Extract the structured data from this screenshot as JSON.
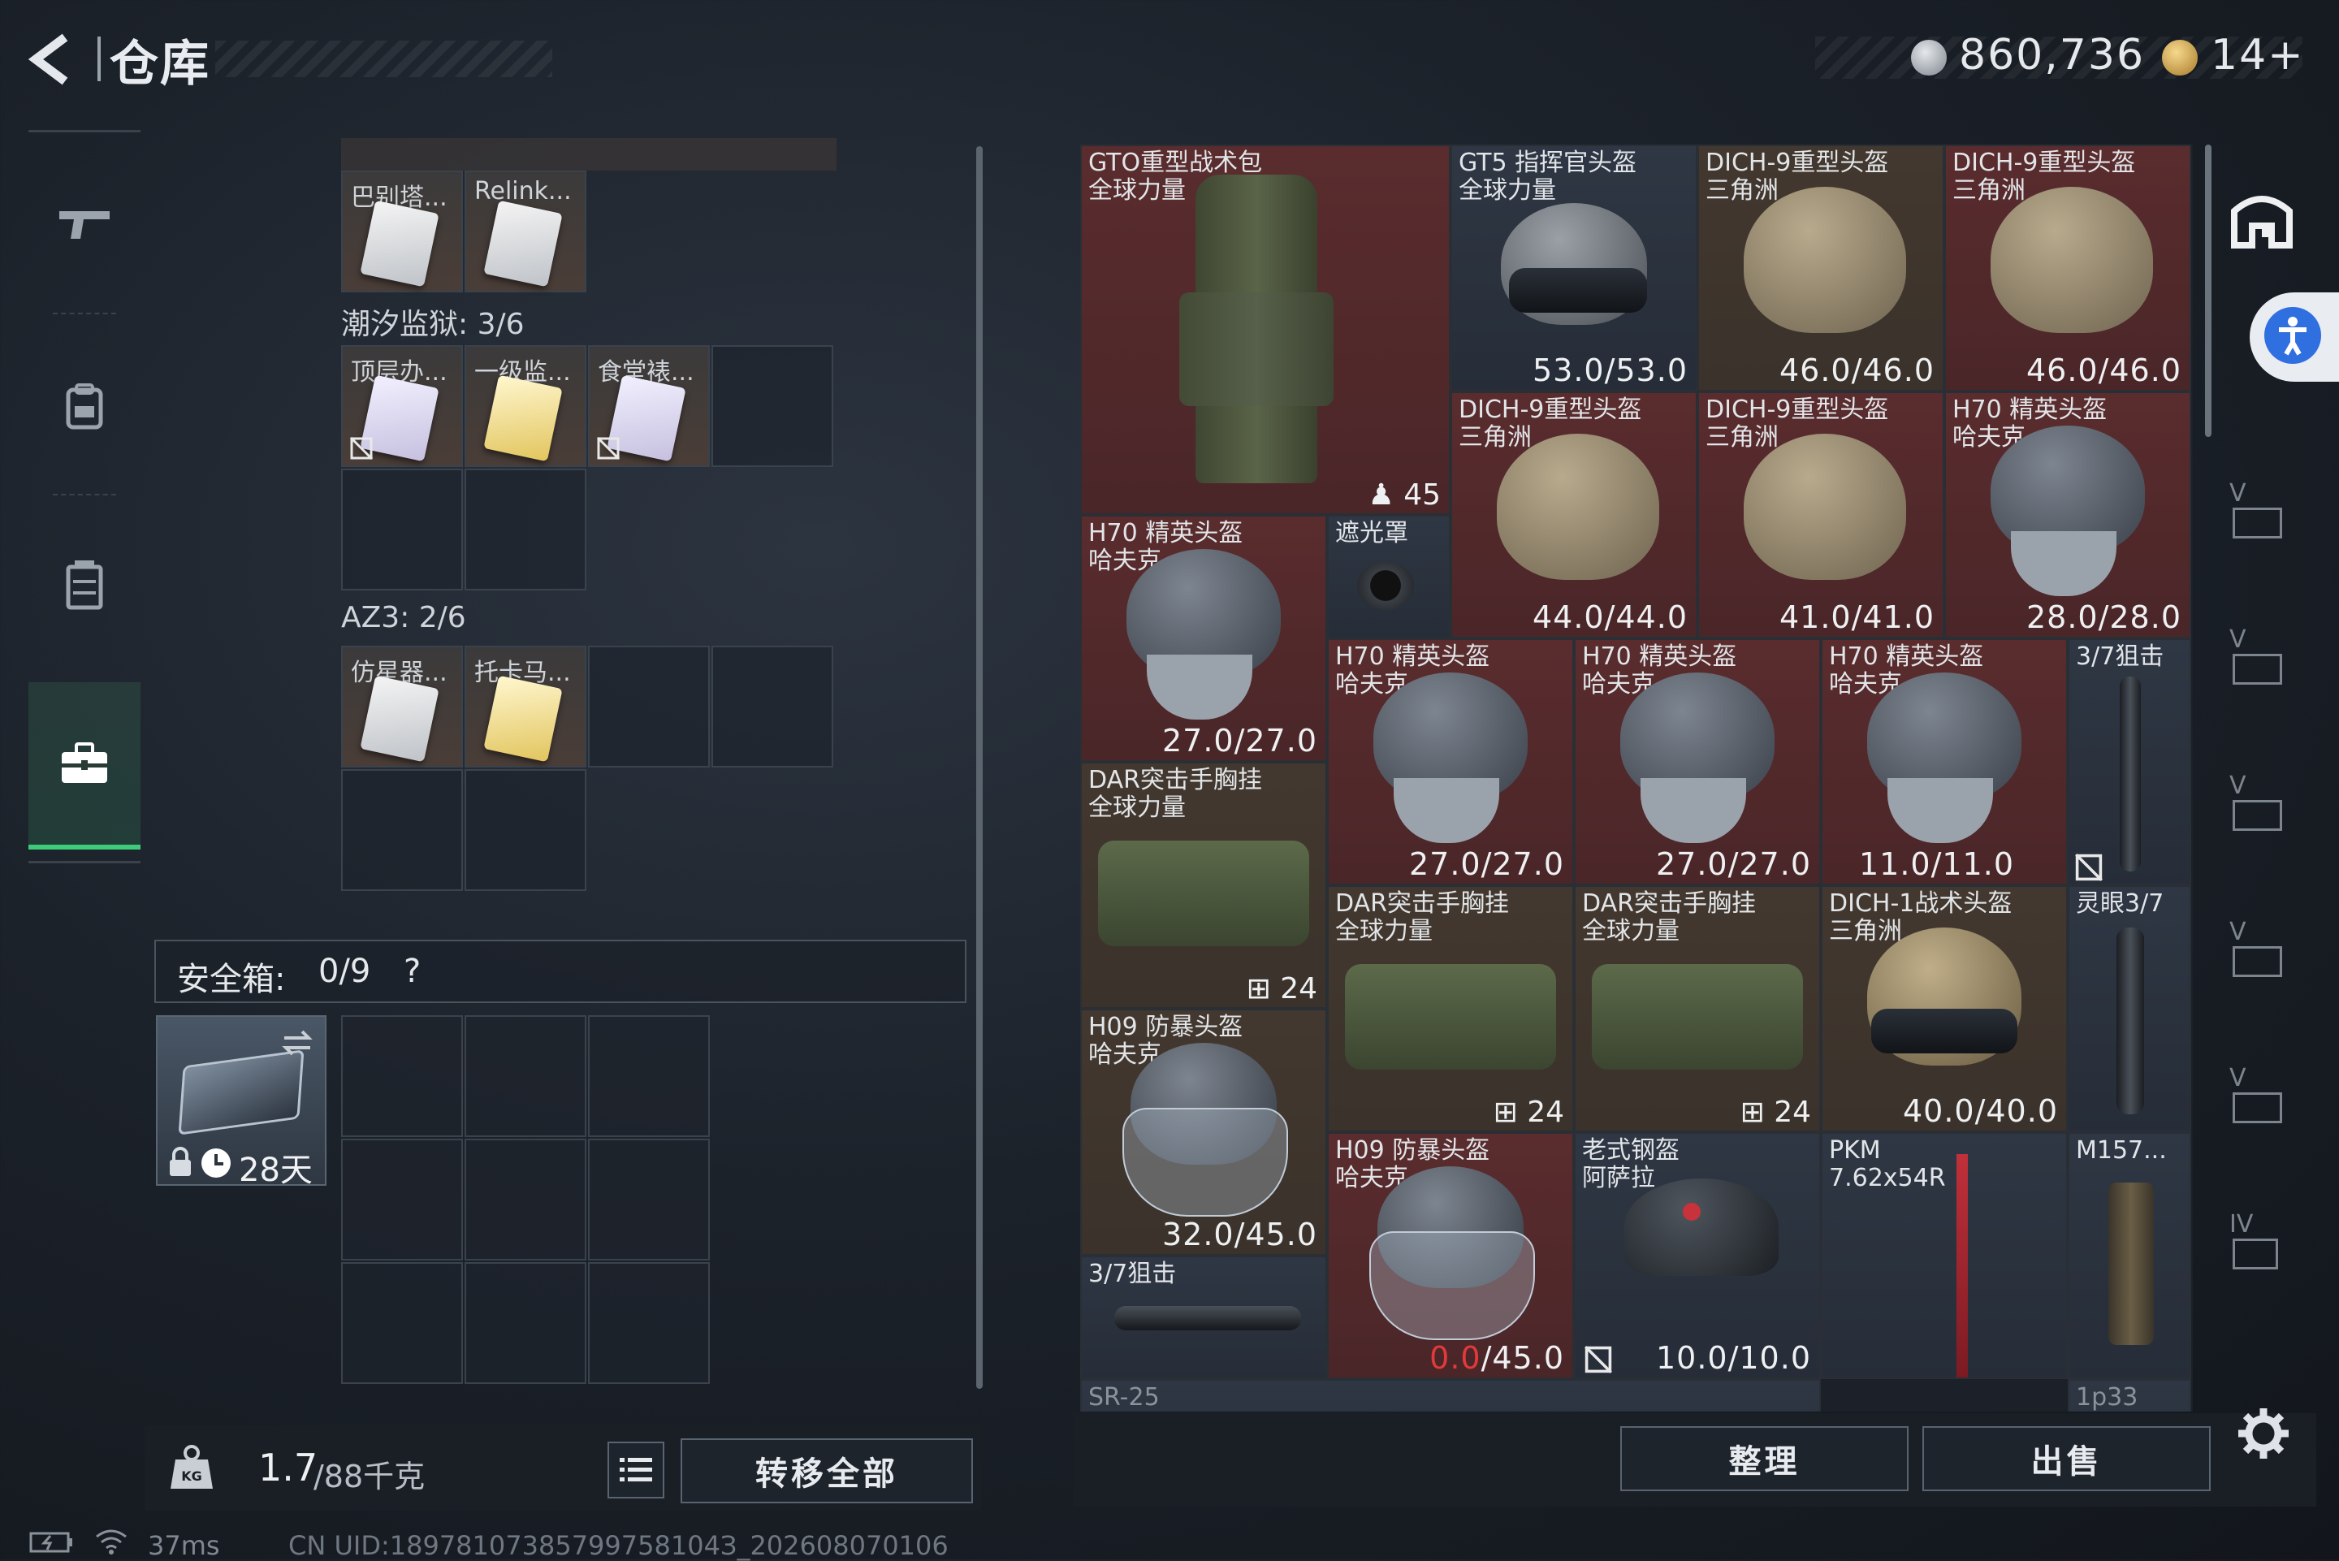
{
  "header": {
    "title": "仓库",
    "currency_amount": "860,736",
    "ticket_amount": "14+"
  },
  "nav": {
    "items": [
      "weapon-icon",
      "backpack-icon",
      "chest-rig-icon",
      "safebox-icon"
    ],
    "active_index": 3
  },
  "containers": [
    {
      "name": "",
      "items": [
        {
          "label": "巴别塔...",
          "color": "white"
        },
        {
          "label": "Relink...",
          "color": "white"
        }
      ]
    },
    {
      "name": "潮汐监狱: 3/6",
      "items": [
        {
          "label": "顶层办...",
          "color": "purple",
          "no_carry": true
        },
        {
          "label": "一级监...",
          "color": "yellow"
        },
        {
          "label": "食堂裱...",
          "color": "purple",
          "no_carry": true
        }
      ]
    },
    {
      "name": "AZ3: 2/6",
      "items": [
        {
          "label": "仿星器...",
          "color": "white"
        },
        {
          "label": "托卡马...",
          "color": "yellow"
        }
      ]
    }
  ],
  "safebox": {
    "label": "安全箱:",
    "count": "0/9",
    "help": "?",
    "item_days": "28天"
  },
  "bottom_left": {
    "weight_value": "1.7",
    "weight_total": "/88千克",
    "weight_icon_text": "KG",
    "transfer_all": "转移全部"
  },
  "storage_items": [
    {
      "name": "GTO重型战术包",
      "sub": "全球力量",
      "extra": "45",
      "type": "backpack"
    },
    {
      "name": "GT5 指挥官头盔",
      "sub": "全球力量",
      "durability": "53.0/53.0",
      "type": "helmet-gt5"
    },
    {
      "name": "DICH-9重型头盔",
      "sub": "三角洲",
      "durability": "46.0/46.0",
      "type": "helmet-dich9"
    },
    {
      "name": "DICH-9重型头盔",
      "sub": "三角洲",
      "durability": "46.0/46.0",
      "type": "helmet-dich9"
    },
    {
      "name": "DICH-9重型头盔",
      "sub": "三角洲",
      "durability": "44.0/44.0",
      "type": "helmet-dich9"
    },
    {
      "name": "DICH-9重型头盔",
      "sub": "三角洲",
      "durability": "41.0/41.0",
      "type": "helmet-dich9"
    },
    {
      "name": "H70 精英头盔",
      "sub": "哈夫克",
      "durability": "28.0/28.0",
      "type": "helmet-h70"
    },
    {
      "name": "H70 精英头盔",
      "sub": "哈夫克",
      "durability": "27.0/27.0",
      "type": "helmet-h70"
    },
    {
      "name": "遮光罩",
      "sub": "",
      "type": "shade"
    },
    {
      "name": "H70 精英头盔",
      "sub": "哈夫克",
      "durability": "27.0/27.0",
      "type": "helmet-h70"
    },
    {
      "name": "H70 精英头盔",
      "sub": "哈夫克",
      "durability": "27.0/27.0",
      "type": "helmet-h70"
    },
    {
      "name": "H70 精英头盔",
      "sub": "哈夫克",
      "durability": "11.0/11.0",
      "type": "helmet-h70"
    },
    {
      "name": "3/7狙击",
      "sub": "",
      "type": "scope-vertical"
    },
    {
      "name": "DAR突击手胸挂",
      "sub": "全球力量",
      "extra": "24",
      "type": "rig"
    },
    {
      "name": "DAR突击手胸挂",
      "sub": "全球力量",
      "extra": "24",
      "type": "rig"
    },
    {
      "name": "DAR突击手胸挂",
      "sub": "全球力量",
      "extra": "24",
      "type": "rig"
    },
    {
      "name": "DICH-1战术头盔",
      "sub": "三角洲",
      "durability": "40.0/40.0",
      "type": "helmet-dich1"
    },
    {
      "name": "灵眼3/7",
      "sub": "",
      "type": "scope-vertical"
    },
    {
      "name": "H09 防暴头盔",
      "sub": "哈夫克",
      "durability": "32.0/45.0",
      "type": "helmet-h09"
    },
    {
      "name": "H09 防暴头盔",
      "sub": "哈夫克",
      "durability_broken": "0.0",
      "durability_max": "/45.0",
      "type": "helmet-h09"
    },
    {
      "name": "老式钢盔",
      "sub": "阿萨拉",
      "durability": "10.0/10.0",
      "type": "helmet-steel"
    },
    {
      "name": "PKM",
      "sub": "7.62x54R",
      "type": "ammo"
    },
    {
      "name": "M157...",
      "sub": "",
      "type": "sight"
    },
    {
      "name": "3/7狙击",
      "sub": "",
      "type": "scope-horizontal"
    },
    {
      "name": "SR-25",
      "sub": "",
      "type": "partial"
    },
    {
      "name": "1p33",
      "sub": "",
      "type": "partial"
    }
  ],
  "side_tiers": [
    "V",
    "V",
    "V",
    "V",
    "V",
    "IV"
  ],
  "bottom_right": {
    "sort": "整理",
    "sell": "出售"
  },
  "status": {
    "ping": "37ms",
    "uid": "CN UID:18978107385799758104З_202608070106"
  },
  "colors": {
    "rarity_red": "#5a2c2e",
    "rarity_brown": "#43382f",
    "active_nav": "#3ecb7a",
    "broken_durability": "#e03a3a",
    "accessibility_blue": "#2f6fe0"
  }
}
